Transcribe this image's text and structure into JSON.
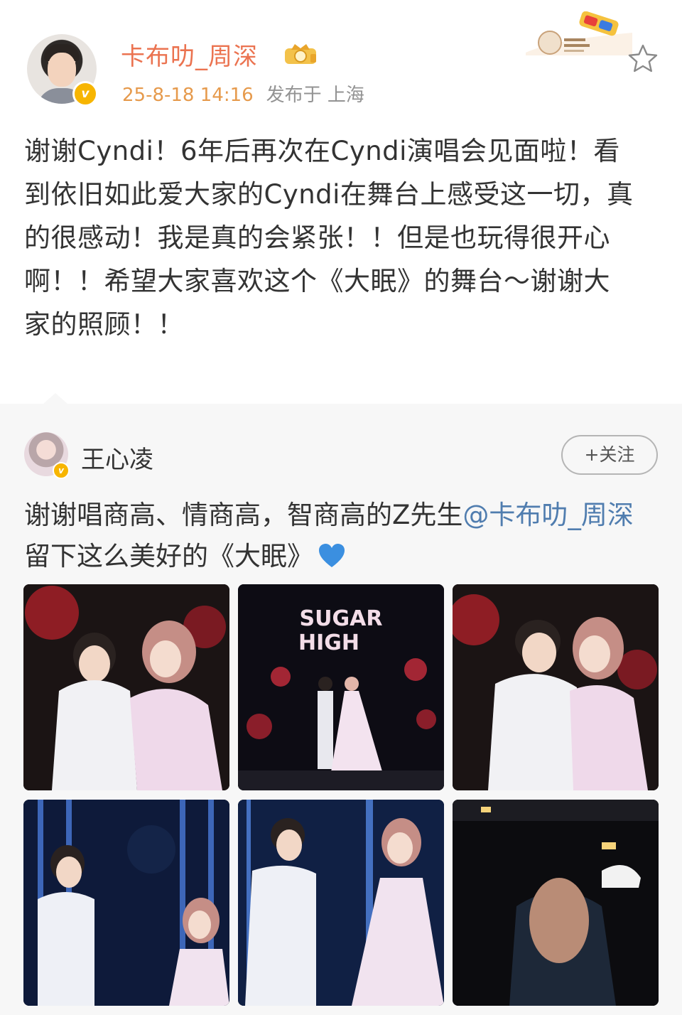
{
  "post": {
    "author": "卡布叻_周深",
    "time": "25-8-18 14:16",
    "location": "发布于 上海",
    "text": "谢谢Cyndi！6年后再次在Cyndi演唱会见面啦！看到依旧如此爱大家的Cyndi在舞台上感受这一切，真的很感动！我是真的会紧张！！但是也玩得很开心啊！！希望大家喜欢这个《大眠》的舞台～谢谢大家的照顾！！"
  },
  "repost": {
    "author": "王心凌",
    "follow_label": "+关注",
    "text_before": "谢谢唱商高、情商高，智商高的Z先生",
    "mention": "@卡布叻_周深",
    "text_after": " 留下这么美好的《大眠》",
    "photos": [
      {
        "icon": "concert-photo-hug"
      },
      {
        "icon": "concert-photo-stage"
      },
      {
        "icon": "concert-photo-hug-smile"
      },
      {
        "icon": "concert-photo-singing"
      },
      {
        "icon": "concert-photo-duet"
      },
      {
        "icon": "backstage-photo-hug"
      }
    ]
  },
  "colors": {
    "author_orange": "#eb7350",
    "time_orange": "#e69a4c",
    "link_blue": "#507daf",
    "verified_gold": "#f7b500",
    "repost_bg": "#f7f7f7"
  }
}
